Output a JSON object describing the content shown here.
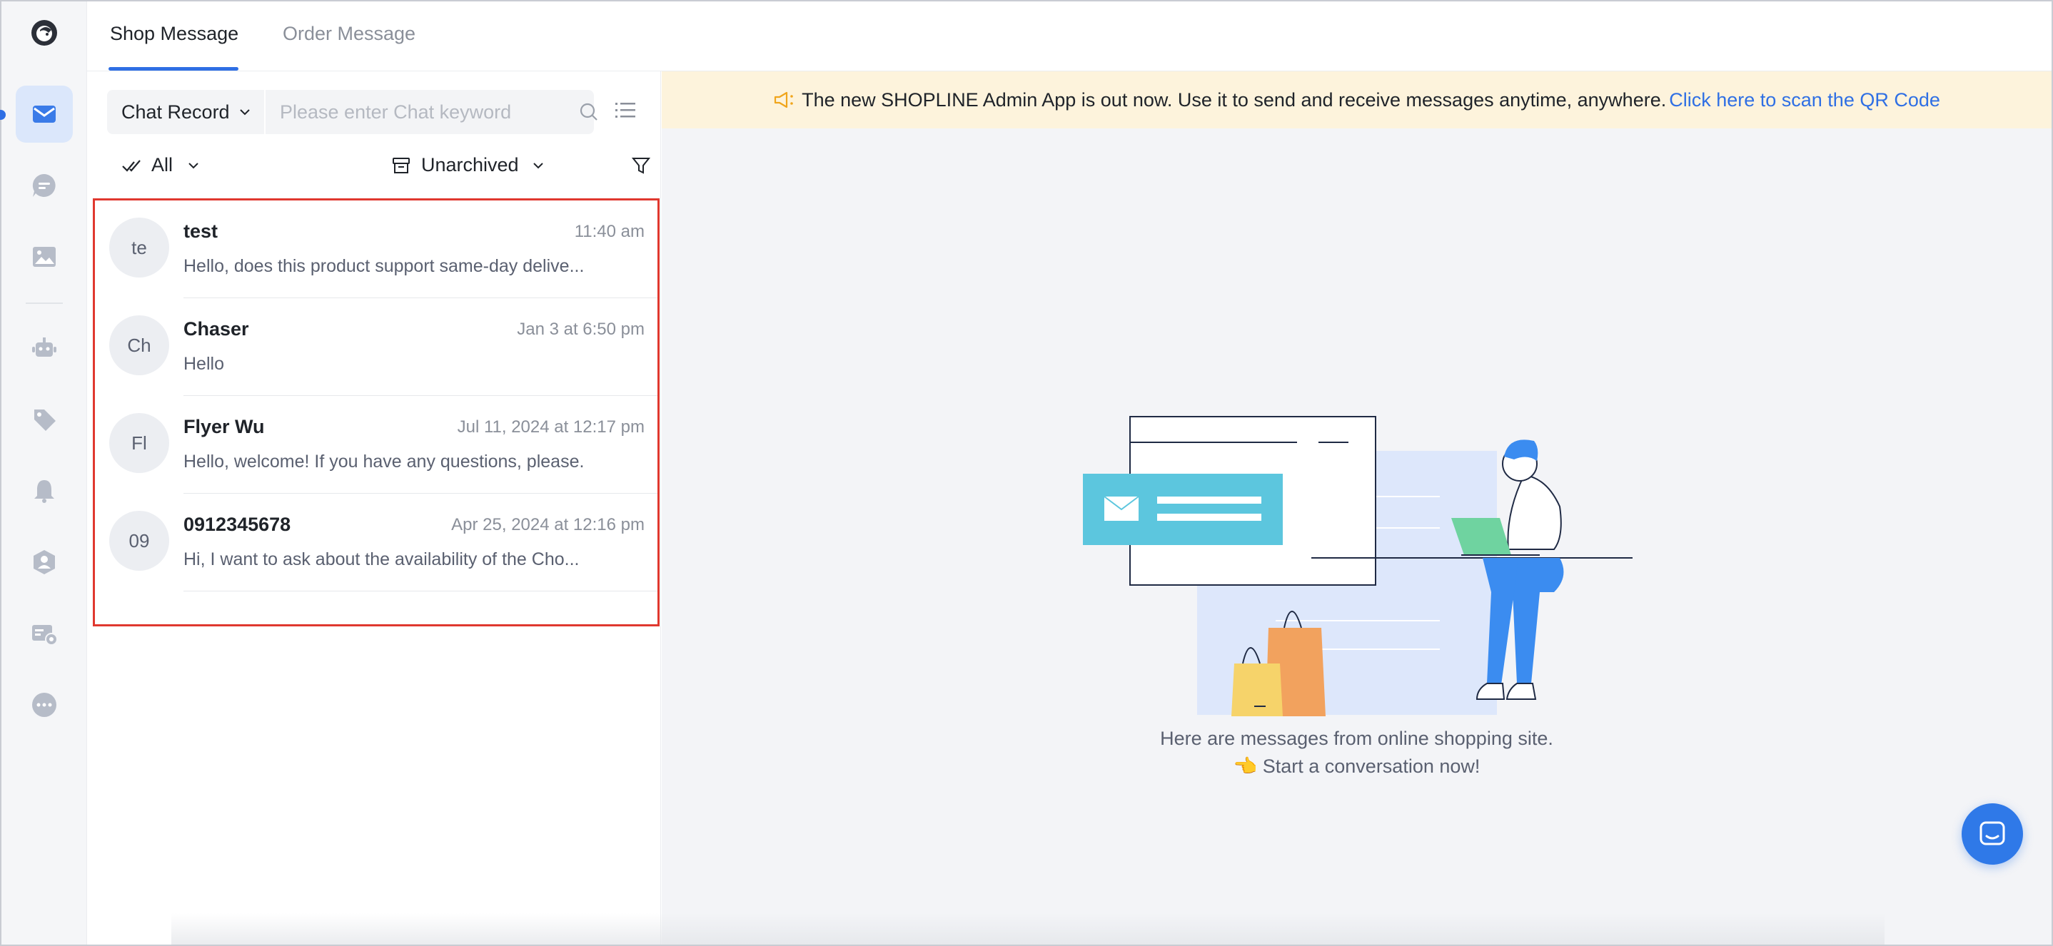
{
  "tabs": [
    {
      "label": "Shop Message",
      "active": true
    },
    {
      "label": "Order Message",
      "active": false
    }
  ],
  "rail": {
    "items": [
      {
        "icon": "mail-icon",
        "active": true
      },
      {
        "icon": "chat-bubble-icon",
        "active": false
      },
      {
        "icon": "image-icon",
        "active": false
      },
      {
        "icon": "robot-icon",
        "active": false
      },
      {
        "icon": "tag-icon",
        "active": false
      },
      {
        "icon": "bell-icon",
        "active": false
      },
      {
        "icon": "user-shield-icon",
        "active": false
      },
      {
        "icon": "card-settings-icon",
        "active": false
      },
      {
        "icon": "more-icon",
        "active": false
      }
    ]
  },
  "search": {
    "select_label": "Chat Record",
    "placeholder": "Please enter Chat keyword",
    "value": ""
  },
  "filters": {
    "read_filter": "All",
    "archive_filter": "Unarchived"
  },
  "conversations": [
    {
      "initials": "te",
      "name": "test",
      "time": "11:40 am",
      "preview": "Hello, does this product support same-day delive..."
    },
    {
      "initials": "Ch",
      "name": "Chaser",
      "time": "Jan 3 at 6:50 pm",
      "preview": "Hello"
    },
    {
      "initials": "Fl",
      "name": "Flyer Wu",
      "time": "Jul 11, 2024 at 12:17 pm",
      "preview": "Hello, welcome! If you have any questions, please..."
    },
    {
      "initials": "09",
      "name": "0912345678",
      "time": "Apr 25, 2024 at 12:16 pm",
      "preview": "Hi, I want to ask about the availability of the Cho..."
    }
  ],
  "banner": {
    "text": "The new SHOPLINE Admin App is out now. Use it to send and receive messages anytime, anywhere.",
    "link": "Click here to scan the QR Code"
  },
  "empty_state": {
    "line1": "Here are messages from online shopping site.",
    "line2": "👈 Start a conversation now!"
  },
  "colors": {
    "accent": "#2f6fe4",
    "highlight_border": "#e0382f",
    "banner_bg": "#fdf3dc"
  }
}
